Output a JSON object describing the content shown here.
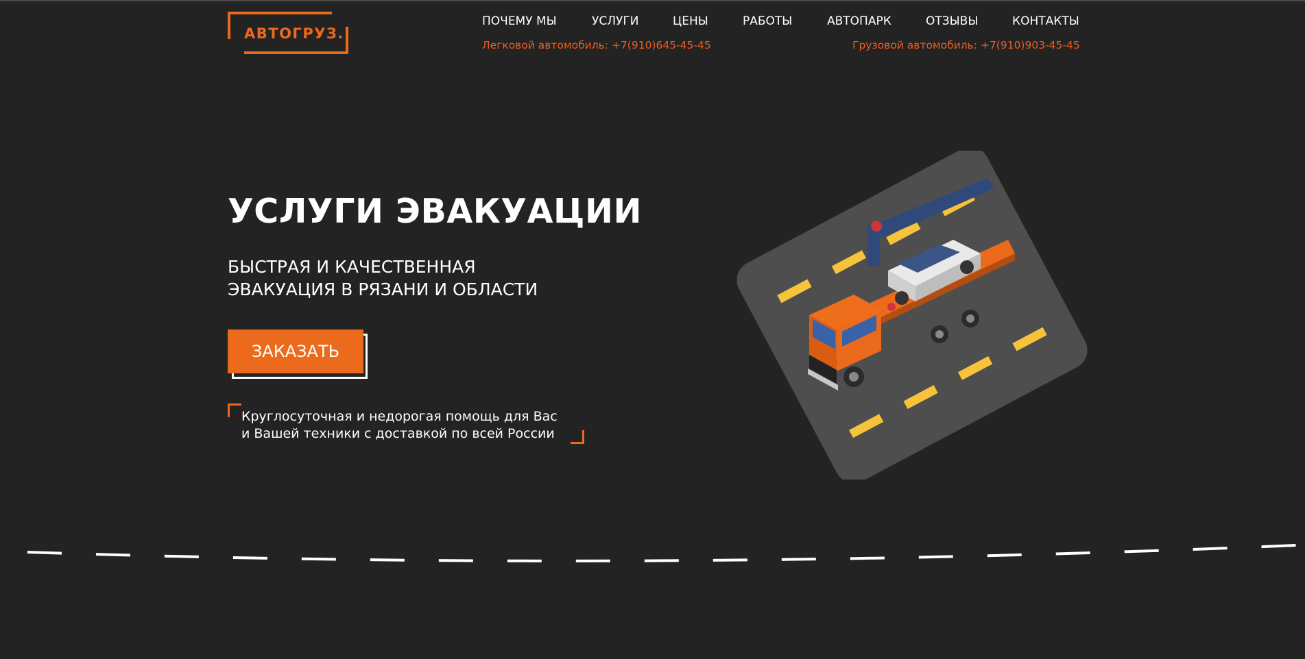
{
  "logo": {
    "text": "АВТОГРУЗ."
  },
  "nav": {
    "items": [
      {
        "label": "ПОЧЕМУ МЫ"
      },
      {
        "label": "УСЛУГИ"
      },
      {
        "label": "ЦЕНЫ"
      },
      {
        "label": "РАБОТЫ"
      },
      {
        "label": "АВТОПАРК"
      },
      {
        "label": "ОТЗЫВЫ"
      },
      {
        "label": "КОНТАКТЫ"
      }
    ]
  },
  "phones": {
    "car": "Легковой автомобиль: +7(910)645-45-45",
    "truck": "Грузовой автомобиль: +7(910)903-45-45"
  },
  "hero": {
    "title": "УСЛУГИ ЭВАКУАЦИИ",
    "subtitle_line1": "БЫСТРАЯ И КАЧЕСТВЕННАЯ",
    "subtitle_line2": "ЭВАКУАЦИЯ В РЯЗАНИ И ОБЛАСТИ",
    "order_button": "ЗАКАЗАТЬ",
    "note_line1": "Круглосуточная и недорогая помощь для Вас",
    "note_line2": "и Вашей техники с доставкой по всей России"
  },
  "illustration": {
    "icon": "tow-truck-illustration"
  },
  "colors": {
    "background": "#232323",
    "accent": "#ec6a1c",
    "phone_text": "#ec5d22",
    "road": "#4e4e4e",
    "lane_marking": "#f6c33a"
  }
}
